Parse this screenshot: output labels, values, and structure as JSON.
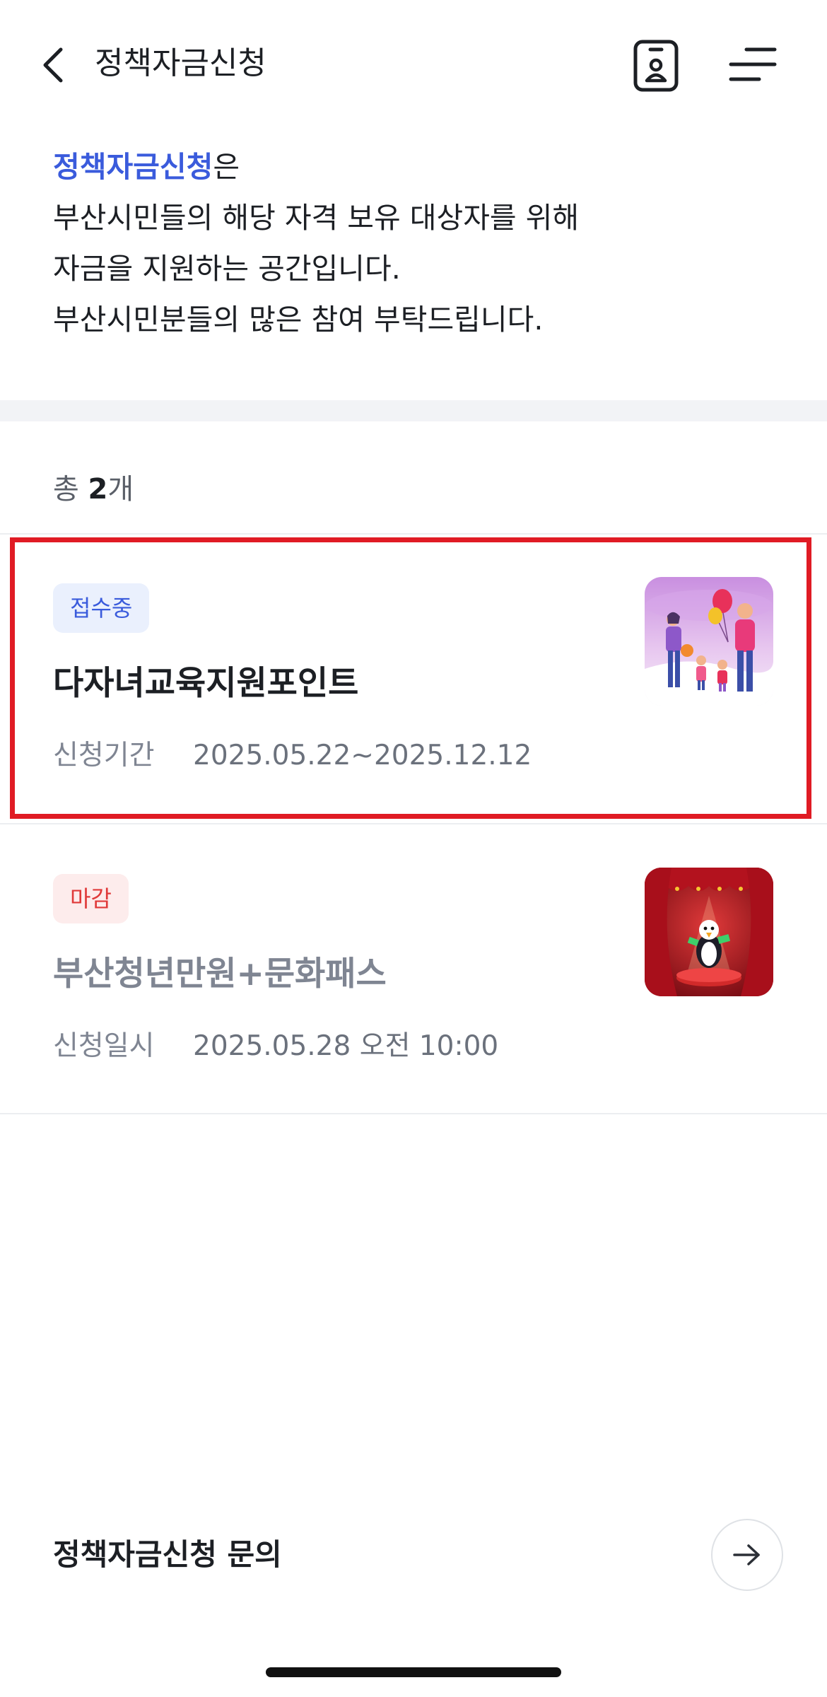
{
  "header": {
    "title": "정책자금신청",
    "back_icon": "chevron-left-icon",
    "idcard_icon": "id-card-icon",
    "menu_icon": "hamburger-menu-icon"
  },
  "intro": {
    "accent": "정책자금신청",
    "accent_suffix": "은",
    "line2": "부산시민들의 해당 자격 보유 대상자를 위해",
    "line3": "자금을 지원하는 공간입니다.",
    "line4": "부산시민분들의 많은 참여 부탁드립니다."
  },
  "list": {
    "count_prefix": "총",
    "count": "2",
    "count_suffix": "개",
    "items": [
      {
        "status": "접수중",
        "title": "다자녀교육지원포인트",
        "meta_label": "신청기간",
        "meta_value": "2025.05.22~2025.12.12",
        "thumb_icon": "family-balloon-illustration-icon"
      },
      {
        "status": "마감",
        "title": "부산청년만원+문화패스",
        "meta_label": "신청일시",
        "meta_value": "2025.05.28 오전 10:00",
        "thumb_icon": "stage-mascot-illustration-icon"
      }
    ]
  },
  "inquiry": {
    "label": "정책자금신청 문의",
    "arrow_icon": "arrow-right-icon"
  },
  "colors": {
    "accent": "#3a5bdc",
    "highlight": "#e01b24",
    "closed": "#e03a3a"
  }
}
